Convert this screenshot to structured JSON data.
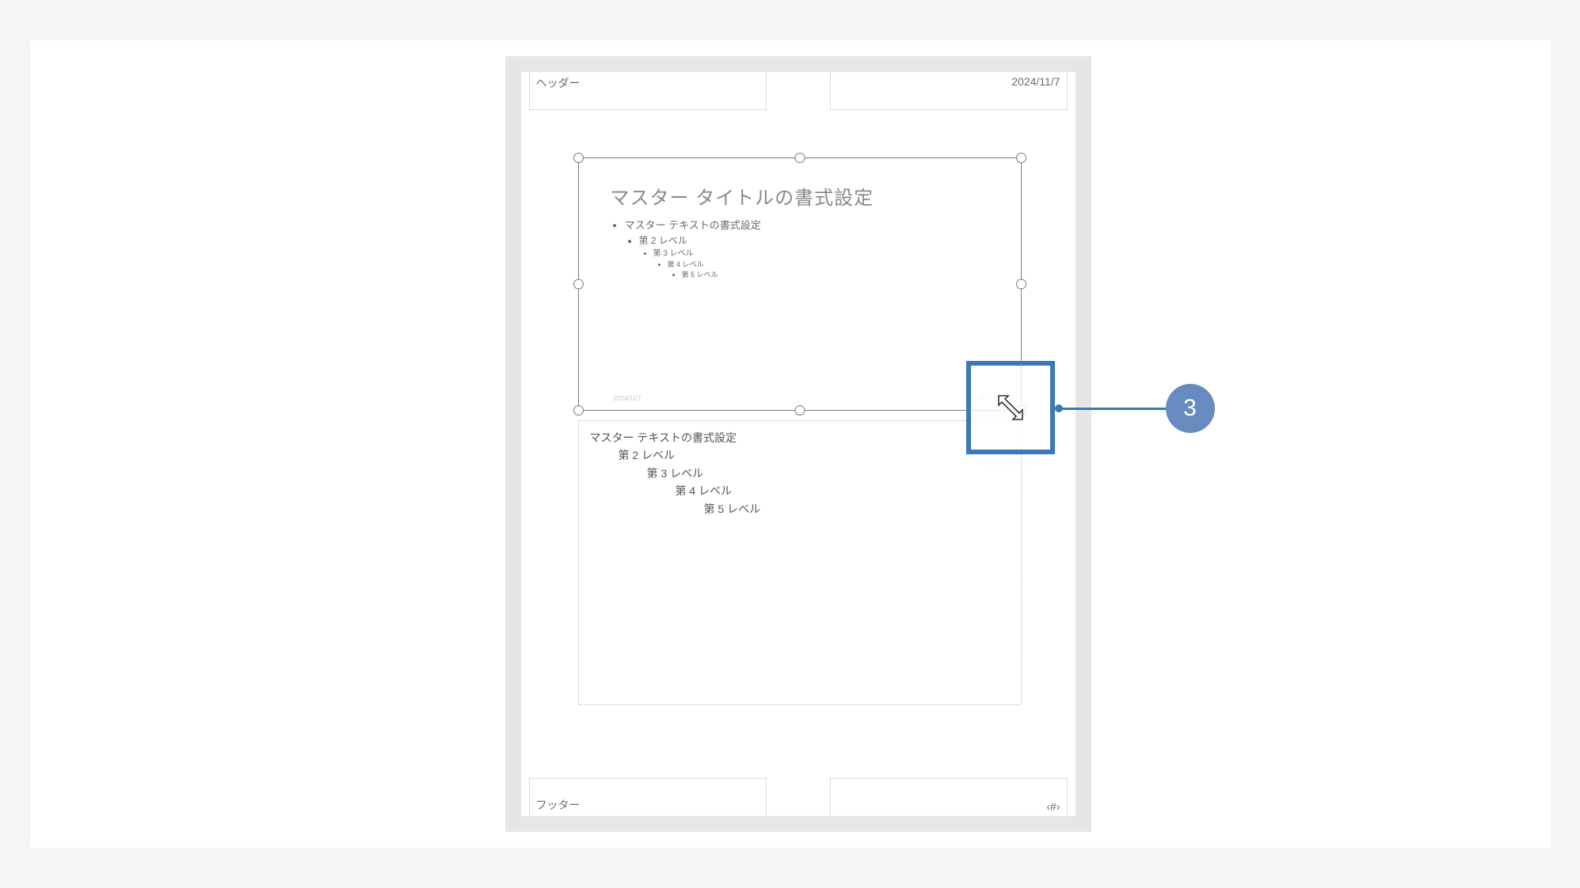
{
  "header": {
    "left": "ヘッダー",
    "right_date": "2024/11/7"
  },
  "footer": {
    "left": "フッター",
    "right_pagenum": "‹#›"
  },
  "slide": {
    "title": "マスター タイトルの書式設定",
    "bullets": {
      "l1": "マスター テキストの書式設定",
      "l2": "第 2 レベル",
      "l3": "第 3 レベル",
      "l4": "第 4 レベル",
      "l5": "第 5 レベル"
    },
    "footer_date": "2024/11/7",
    "footer_page": "‹#›"
  },
  "notes": {
    "l1": "マスター テキストの書式設定",
    "l2": "第 2 レベル",
    "l3": "第 3 レベル",
    "l4": "第 4 レベル",
    "l5": "第 5 レベル"
  },
  "callout": {
    "number": "3"
  }
}
